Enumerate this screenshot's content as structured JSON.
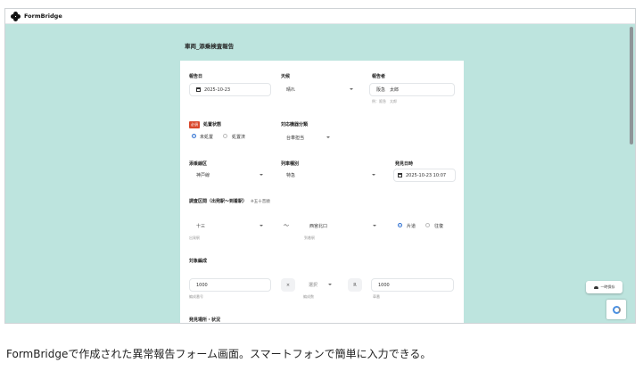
{
  "app": {
    "name": "FormBridge"
  },
  "form": {
    "title": "車両_添乗検査報告",
    "report_date": {
      "label": "報告日",
      "value": "2025-10-23"
    },
    "weather": {
      "label": "天候",
      "value": "晴れ"
    },
    "reporter": {
      "label": "報告者",
      "value": "阪急　太郎",
      "hint": "例：阪急　太郎"
    },
    "required_badge": "必須",
    "handling": {
      "label": "処置状態",
      "options": [
        "未処置",
        "処置済"
      ],
      "selected": "未処置"
    },
    "device_category": {
      "label": "対応機器分類",
      "value": "台車担当"
    },
    "line": {
      "label": "添乗線区",
      "value": "神戸線"
    },
    "train_type": {
      "label": "列車種別",
      "value": "特急"
    },
    "found_datetime": {
      "label": "発見日時",
      "value": "2025-10-23 10:07"
    },
    "section": {
      "label": "調査区間（出発駅〜到着駅）",
      "note": "※五十音順",
      "departure": {
        "value": "十三",
        "hint": "出発駅"
      },
      "separator": "〜",
      "arrival": {
        "value": "西宮北口",
        "hint": "到着駅"
      },
      "direction": {
        "options": [
          "片道",
          "往復"
        ],
        "selected": "片道"
      }
    },
    "formation": {
      "label": "対象編成",
      "car_number": {
        "value": "1000",
        "hint": "編成番号"
      },
      "times_symbol": "×",
      "composition": {
        "value": "選択",
        "hint": "編成数"
      },
      "r_symbol": "R",
      "car_no": {
        "value": "1000",
        "hint": "車番"
      }
    },
    "found_place": {
      "label": "発見場所・状況"
    }
  },
  "chat_button": {
    "label": "一時保存"
  },
  "caption": "FormBridgeで作成された異常報告フォーム画面。スマートフォンで簡単に入力できる。"
}
